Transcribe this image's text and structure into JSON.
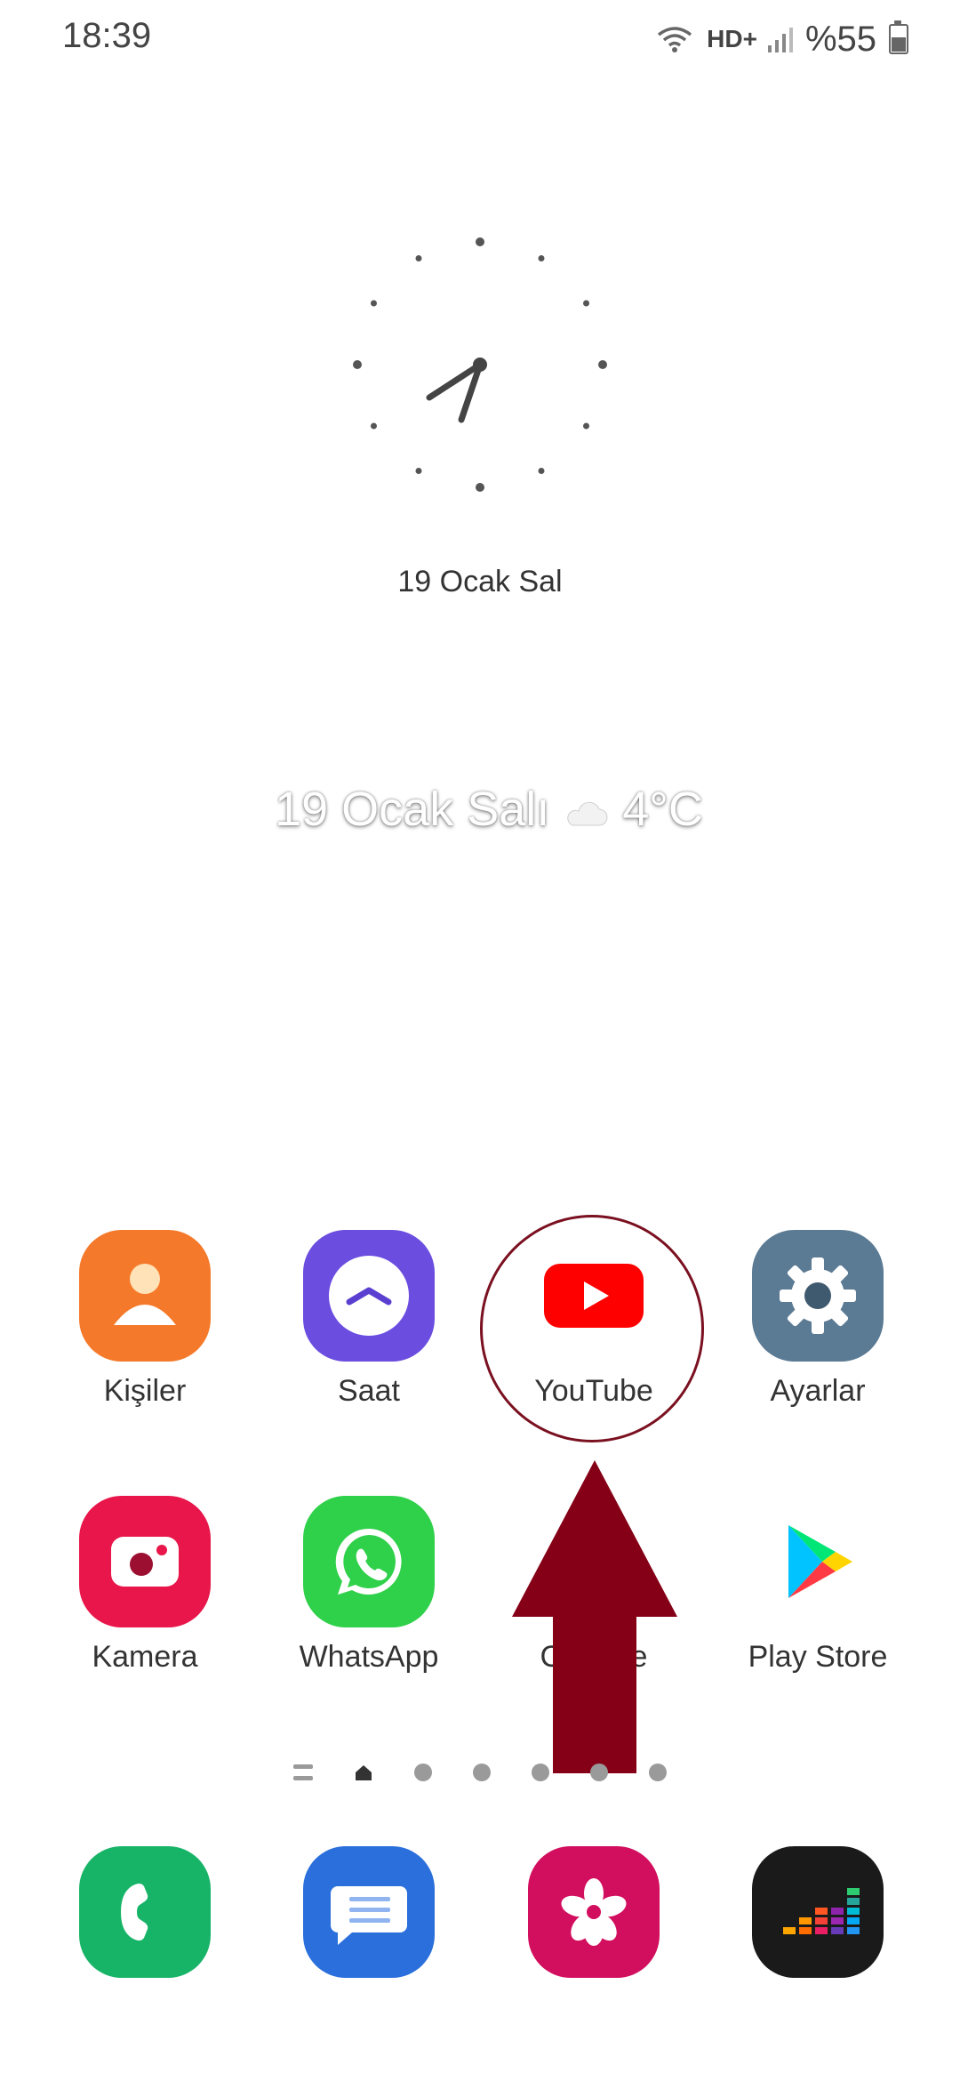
{
  "status_bar": {
    "time": "18:39",
    "network": "HD+",
    "battery": "%55",
    "battery_level": 0.55
  },
  "clock_widget": {
    "time": "18:39",
    "date": "19 Ocak Sal"
  },
  "overlay": {
    "date": "19 Ocak Salı",
    "temperature": "4°C",
    "weather_icon": "cloud-moon-icon"
  },
  "apps": [
    {
      "label": "Kişiler",
      "icon": "person-icon",
      "color": "#f5792a"
    },
    {
      "label": "Saat",
      "icon": "clock-app-icon",
      "color": "#6b4de0"
    },
    {
      "label": "YouTube",
      "icon": "youtube-icon",
      "color": "#ff0000"
    },
    {
      "label": "Ayarlar",
      "icon": "gear-icon",
      "color": "#5b7a93"
    },
    {
      "label": "Kamera",
      "icon": "camera-icon",
      "color": "#e8164a"
    },
    {
      "label": "WhatsApp",
      "icon": "whatsapp-icon",
      "color": "#2fd04a"
    },
    {
      "label": "Chrome",
      "icon": "chrome-icon",
      "color": "#f4b400"
    },
    {
      "label": "Play Store",
      "icon": "play-store-icon",
      "color": "#ffffff"
    }
  ],
  "dock": [
    {
      "icon": "phone-icon",
      "color": "#17b468"
    },
    {
      "icon": "messages-icon",
      "color": "#2a6fdb"
    },
    {
      "icon": "gallery-icon",
      "color": "#d20e5e"
    },
    {
      "icon": "deezer-icon",
      "color": "#1a1a1a"
    }
  ],
  "page_indicator": {
    "pages": 7,
    "current": 1
  },
  "annotation": {
    "color": "#850016"
  }
}
